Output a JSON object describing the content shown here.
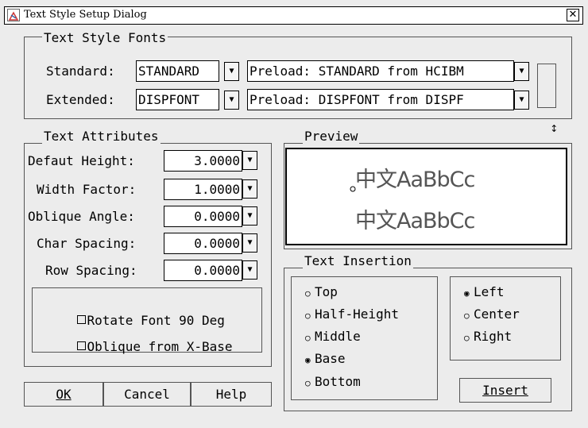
{
  "window": {
    "title": "Text Style Setup Dialog",
    "close_label": "✕"
  },
  "fonts": {
    "title": "Text Style Fonts",
    "standard_label": "Standard:",
    "standard_value": "STANDARD",
    "standard_preload": "Preload: STANDARD from HCIBM",
    "extended_label": "Extended:",
    "extended_value": "DISPFONT",
    "extended_preload": "Preload: DISPFONT from DISPF",
    "swap_icon": "↕"
  },
  "attributes": {
    "title": "Text Attributes",
    "rows": [
      {
        "label": "Defaut Height:",
        "value": "3.0000"
      },
      {
        "label": "Width Factor:",
        "value": "1.0000"
      },
      {
        "label": "Oblique Angle:",
        "value": "0.0000"
      },
      {
        "label": "Char Spacing:",
        "value": "0.0000"
      },
      {
        "label": "Row Spacing:",
        "value": "0.0000"
      }
    ],
    "rotate_label": "Rotate Font 90 Deg",
    "oblique_label": "Oblique from X-Base"
  },
  "preview": {
    "title": "Preview",
    "line1": "中文AaBbCc",
    "line2": "中文AaBbCc"
  },
  "insertion": {
    "title": "Text Insertion",
    "vertical": [
      {
        "label": "Top",
        "selected": false
      },
      {
        "label": "Half-Height",
        "selected": false
      },
      {
        "label": "Middle",
        "selected": false
      },
      {
        "label": "Base",
        "selected": true
      },
      {
        "label": "Bottom",
        "selected": false
      }
    ],
    "horizontal": [
      {
        "label": "Left",
        "selected": true
      },
      {
        "label": "Center",
        "selected": false
      },
      {
        "label": "Right",
        "selected": false
      }
    ],
    "insert_button": "Insert"
  },
  "buttons": {
    "ok": "OK",
    "cancel": "Cancel",
    "help": "Help"
  }
}
